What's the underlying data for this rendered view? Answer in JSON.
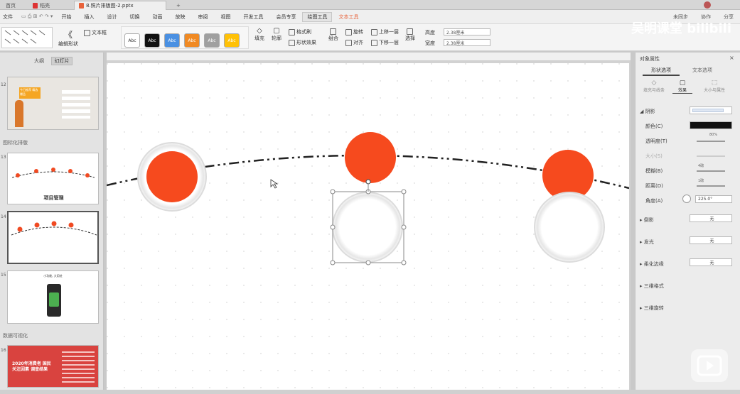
{
  "window_tabs": [
    "首页",
    "稻壳",
    "8.照片排版图-2.pptx"
  ],
  "window_tab_add": "+",
  "menu": {
    "file": "文件",
    "items": [
      "开始",
      "插入",
      "设计",
      "切换",
      "动画",
      "放映",
      "审阅",
      "视图",
      "开发工具",
      "会员专享"
    ],
    "context_tab": "绘图工具",
    "extra_tab": "文本工具",
    "right": [
      "未同步",
      "协作",
      "分享"
    ]
  },
  "ribbon": {
    "styles": [
      "Abc",
      "Abc",
      "Abc",
      "Abc",
      "Abc",
      "Abc"
    ],
    "style_colors": [
      "#ffffff",
      "#111111",
      "#4a90e2",
      "#f08a24",
      "#a0a0a0",
      "#ffc107"
    ],
    "text_box": "文本框",
    "edit_shape": "编辑形状",
    "fill": "填充",
    "outline": "轮廓",
    "format_painter": "格式刷",
    "shape_effect": "形状效果",
    "combine": "组合",
    "rotate": "旋转",
    "align": "对齐",
    "bring_forward": "上移一层",
    "send_backward": "下移一层",
    "select": "选择",
    "height_label": "高度",
    "height_value": "2.38厘米",
    "width_label": "宽度",
    "width_value": "2.38厘米"
  },
  "left_panel": {
    "tabs": [
      "大纲",
      "幻灯片"
    ],
    "section_labels": [
      "图标化排版",
      "数据可视化"
    ],
    "slides": [
      {
        "num": "12",
        "text": "今日推荐 精选爆品"
      },
      {
        "num": "13",
        "text": "项目管理"
      },
      {
        "num": "14",
        "text": ""
      },
      {
        "num": "15",
        "text": "小功能, 大用处"
      },
      {
        "num": "16",
        "text": "2020年消费者 国民关注因素 调查结果"
      }
    ]
  },
  "right_panel": {
    "title": "对象属性",
    "tabs": [
      "形状选项",
      "文本选项"
    ],
    "sub_tabs": [
      "填充与线条",
      "效果",
      "大小与属性"
    ],
    "shadow_section": "阴影",
    "rows": [
      {
        "label": "颜色(C)",
        "value": ""
      },
      {
        "label": "透明度(T)",
        "value": "80%"
      },
      {
        "label": "大小(S)",
        "value": ""
      },
      {
        "label": "模糊(B)",
        "value": "4磅"
      },
      {
        "label": "距离(D)",
        "value": "1磅"
      },
      {
        "label": "角度(A)",
        "value": "225.0°"
      }
    ],
    "sections": [
      {
        "label": "倒影",
        "value": "无"
      },
      {
        "label": "发光",
        "value": "无"
      },
      {
        "label": "柔化边缘",
        "value": "无"
      },
      {
        "label": "三维格式",
        "value": ""
      },
      {
        "label": "三维旋转",
        "value": ""
      }
    ]
  },
  "watermark": "吴明课堂 bilibili"
}
